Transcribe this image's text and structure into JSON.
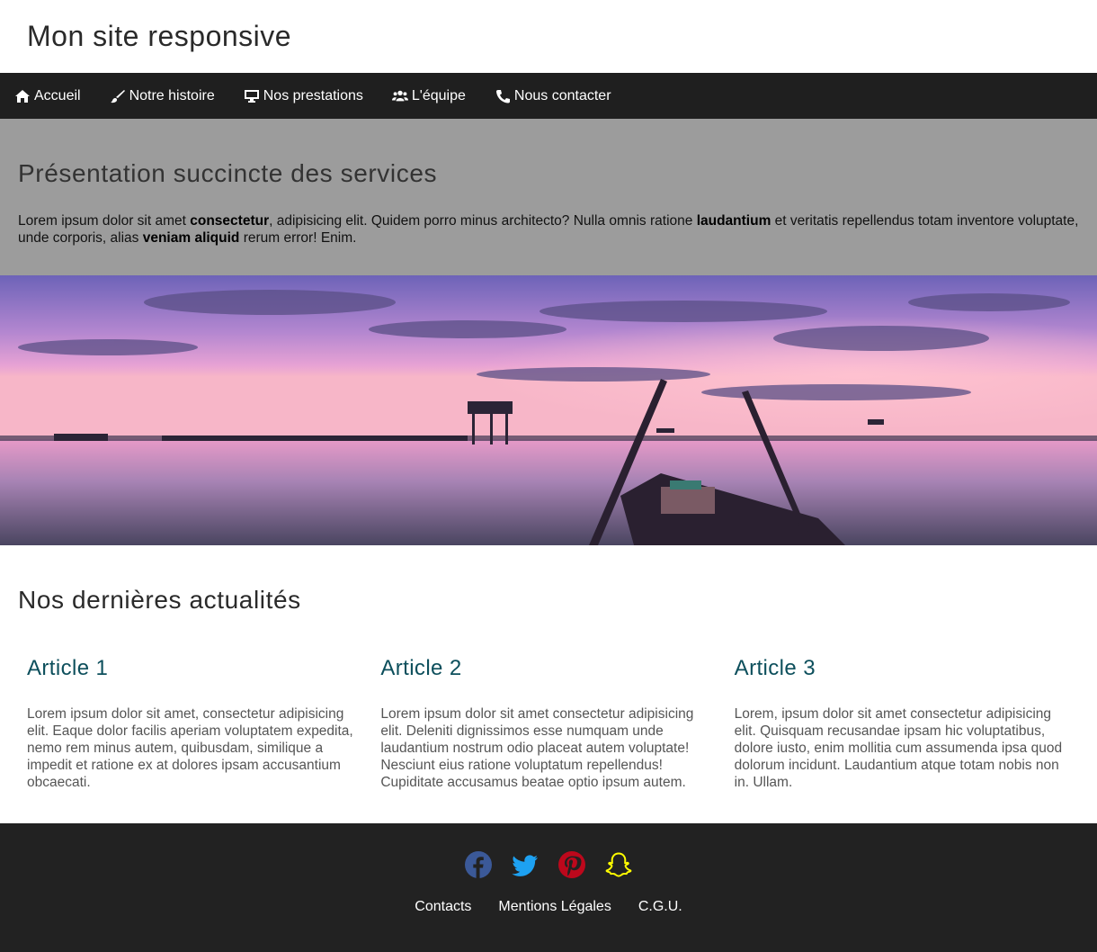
{
  "site": {
    "title": "Mon site responsive"
  },
  "nav": {
    "items": [
      {
        "label": "Accueil",
        "icon": "home-icon"
      },
      {
        "label": "Notre histoire",
        "icon": "paintbrush-icon"
      },
      {
        "label": "Nos prestations",
        "icon": "desktop-icon"
      },
      {
        "label": "L'équipe",
        "icon": "users-icon"
      },
      {
        "label": "Nous contacter",
        "icon": "phone-icon"
      }
    ]
  },
  "intro": {
    "heading": "Présentation succincte des services",
    "p1": "Lorem ipsum dolor sit amet ",
    "b1": "consectetur",
    "p2": ", adipisicing elit. Quidem porro minus architecto? Nulla omnis ratione ",
    "b2": "laudantium",
    "p3": " et veritatis repellendus totam inventore voluptate, unde corporis, alias ",
    "b3": "veniam aliquid",
    "p4": " rerum error! Enim."
  },
  "news": {
    "heading": "Nos dernières actualités",
    "articles": [
      {
        "title": "Article 1",
        "text": "Lorem ipsum dolor sit amet, consectetur adipisicing elit. Eaque dolor facilis aperiam voluptatem expedita, nemo rem minus autem, quibusdam, similique a impedit et ratione ex at dolores ipsam accusantium obcaecati."
      },
      {
        "title": "Article 2",
        "text": "Lorem ipsum dolor sit amet consectetur adipisicing elit. Deleniti dignissimos esse numquam unde laudantium nostrum odio placeat autem voluptate! Nesciunt eius ratione voluptatum repellendus! Cupiditate accusamus beatae optio ipsum autem."
      },
      {
        "title": "Article 3",
        "text": "Lorem, ipsum dolor sit amet consectetur adipisicing elit. Quisquam recusandae ipsam hic voluptatibus, dolore iusto, enim mollitia cum assumenda ipsa quod dolorum incidunt. Laudantium atque totam nobis non in. Ullam."
      }
    ]
  },
  "footer": {
    "social": [
      {
        "icon": "facebook-icon",
        "color": "#3b5998"
      },
      {
        "icon": "twitter-icon",
        "color": "#1da1f2"
      },
      {
        "icon": "pinterest-icon",
        "color": "#bd081c"
      },
      {
        "icon": "snapchat-icon",
        "color": "#fffc00"
      }
    ],
    "links": [
      "Contacts",
      "Mentions Légales",
      "C.G.U."
    ]
  }
}
